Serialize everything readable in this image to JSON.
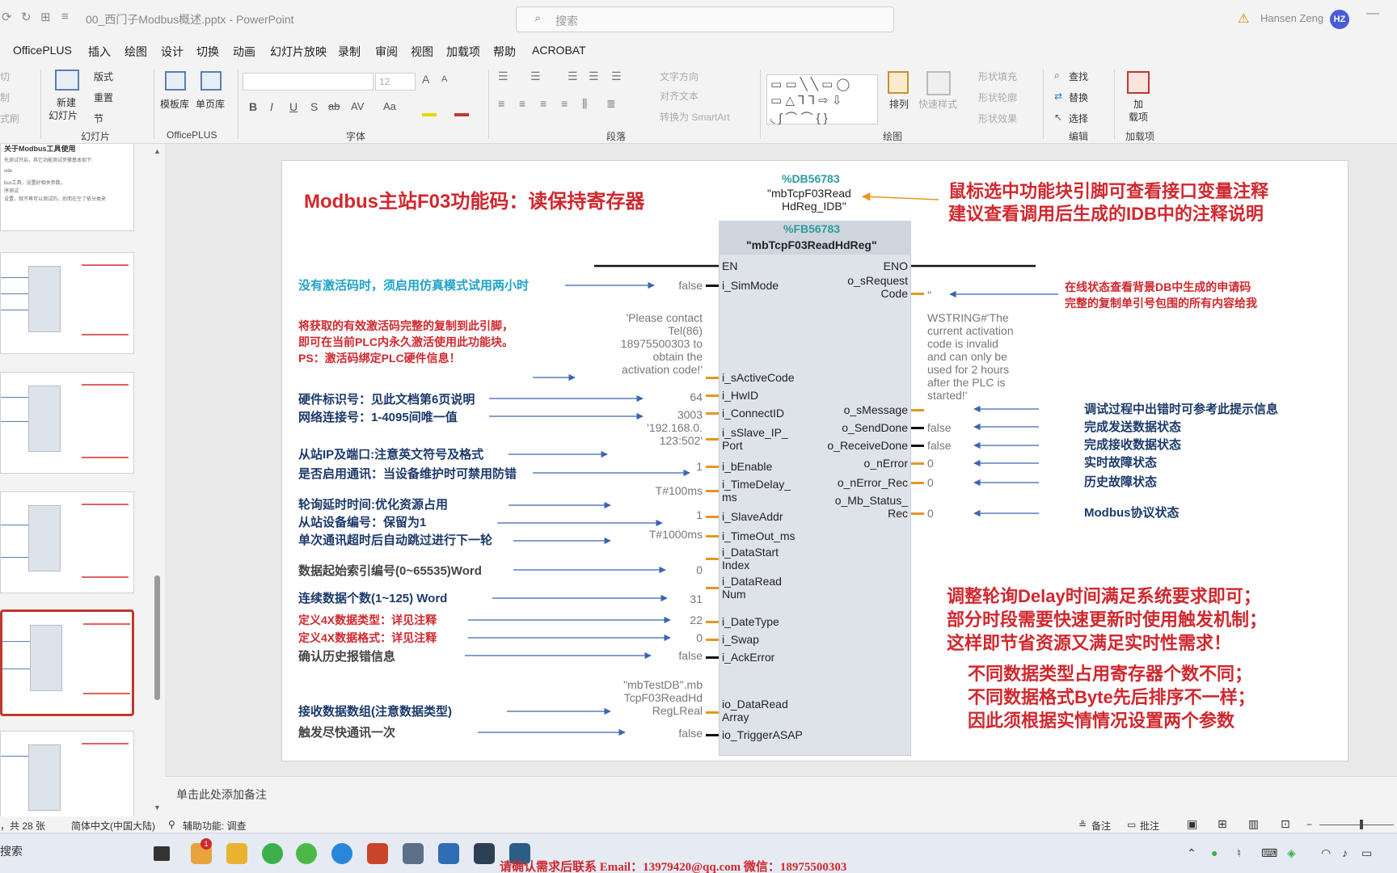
{
  "titlebar": {
    "filename": "00_西门子Modbus概述.pptx - PowerPoint",
    "search_placeholder": "搜索",
    "user_name": "Hansen Zeng",
    "user_initials": "HZ",
    "minimize": "—"
  },
  "menu": [
    "OfficePLUS",
    "插入",
    "绘图",
    "设计",
    "切换",
    "动画",
    "幻灯片放映",
    "录制",
    "审阅",
    "视图",
    "加载项",
    "帮助",
    "ACROBAT"
  ],
  "ribbon": {
    "clip_cut": "切",
    "clip_copy": "制",
    "clip_format": "式刷",
    "slides_group": {
      "new_slide": "新建",
      "new_slide2": "幻灯片",
      "layout": "版式",
      "reset": "重置",
      "section": "节",
      "label": "幻灯片"
    },
    "officeplus_group": {
      "template": "模板库",
      "single_page": "单页库",
      "label": "OfficePLUS"
    },
    "font_group": {
      "font_size": "12",
      "label": "字体",
      "bold": "B",
      "italic": "I",
      "underline": "U",
      "shadow": "S",
      "strike": "ab",
      "spacing": "AV",
      "case": "Aa",
      "grow": "A",
      "shrink": "A"
    },
    "paragraph_group": {
      "text_direction": "文字方向",
      "align_text": "对齐文本",
      "smartart": "转换为 SmartArt",
      "label": "段落"
    },
    "drawing_group": {
      "arrange": "排列",
      "quick_style": "快速样式",
      "fill": "形状填充",
      "outline": "形状轮廓",
      "effect": "形状效果",
      "label": "绘图"
    },
    "editing_group": {
      "find": "查找",
      "replace": "替换",
      "select": "选择",
      "label": "编辑"
    },
    "addins_group": {
      "addin": "加",
      "addin2": "载项",
      "label": "加载项"
    }
  },
  "thumbnail_top_text": {
    "heading": "关于Modbus工具使用",
    "l1": "先测试开启，其它功能测试步骤基本如下:",
    "l2": "ode",
    "l3": "bus工具，设置好相关参数。",
    "l4": "序测试",
    "l5": "设置，就不再可以测试的，后而在空了依分类来"
  },
  "slide": {
    "title": "Modbus主站F03功能码：读保持寄存器",
    "db_number": "%DB56783",
    "db_name_1": "\"mbTcpF03Read",
    "db_name_2": "HdReg_IDB\"",
    "fb_number": "%FB56783",
    "fb_name": "\"mbTcpF03ReadHdReg\"",
    "top_right_note_1": "鼠标选中功能块引脚可查看接口变量注释",
    "top_right_note_2": "建议查看调用后生成的IDB中的注释说明",
    "pins_in": {
      "en": "EN",
      "sim": "i_SimMode",
      "active": "i_sActiveCode",
      "hwid": "i_HwID",
      "connid": "i_ConnectID",
      "slave_ip_1": "i_sSlave_IP_",
      "slave_ip_2": "Port",
      "enable": "i_bEnable",
      "delay_1": "i_TimeDelay_",
      "delay_2": "ms",
      "slaveaddr": "i_SlaveAddr",
      "timeout": "i_TimeOut_ms",
      "start_1": "i_DataStart",
      "start_2": "Index",
      "num_1": "i_DataRead",
      "num_2": "Num",
      "datetype": "i_DateType",
      "swap": "i_Swap",
      "ackerror": "i_AckError",
      "array_1": "io_DataRead",
      "array_2": "Array",
      "trigger": "io_TriggerASAP"
    },
    "pins_out": {
      "eno": "ENO",
      "req_1": "o_sRequest",
      "req_2": "Code",
      "msg": "o_sMessage",
      "senddone": "o_SendDone",
      "recvdone": "o_ReceiveDone",
      "nerror": "o_nError",
      "nerror_rec": "o_nError_Rec",
      "mb_1": "o_Mb_Status_",
      "mb_2": "Rec"
    },
    "values_in": {
      "sim": "false",
      "active_1": "'Please contact",
      "active_2": "Tel(86)",
      "active_3": "18975500303 to",
      "active_4": "obtain the",
      "active_5": "activation code!'",
      "hwid": "64",
      "connid": "3003",
      "ip_1": "'192.168.0.",
      "ip_2": "123:502'",
      "enable": "1",
      "delay": "T#100ms",
      "slaveaddr": "1",
      "timeout": "T#1000ms",
      "start": "0",
      "num": "31",
      "datetype": "22",
      "swap": "0",
      "ackerror": "false",
      "array_1": "\"mbTestDB\".mb",
      "array_2": "TcpF03ReadHd",
      "array_3": "RegLReal",
      "trigger": "false"
    },
    "values_out": {
      "req": "''",
      "msg_1": "WSTRING#'The",
      "msg_2": "current activation",
      "msg_3": "code is invalid",
      "msg_4": "and can only be",
      "msg_5": "used for 2 hours",
      "msg_6": "after the PLC is",
      "msg_7": "started!'",
      "senddone": "false",
      "recvdone": "false",
      "nerror": "0",
      "nerror_rec": "0",
      "mb": "0"
    },
    "notes_left": {
      "sim": "没有激活码时，须启用仿真模式试用两小时",
      "act_1": "将获取的有效激活码完整的复制到此引脚，",
      "act_2": "即可在当前PLC内永久激活使用此功能块。",
      "act_3": "PS：激活码绑定PLC硬件信息！",
      "hwid": "硬件标识号：见此文档第6页说明",
      "connid": "网络连接号：1-4095间唯一值",
      "ip": "从站IP及端口:注意英文符号及格式",
      "enable": "是否启用通讯：当设备维护时可禁用防错",
      "delay": "轮询延时时间:优化资源占用",
      "slave": "从站设备编号：保留为1",
      "timeout": "单次通讯超时后自动跳过进行下一轮",
      "start": "数据起始索引编号(0~65535)Word",
      "num": "连续数据个数(1~125) Word",
      "datetype": "定义4X数据类型：详见注释",
      "swap": "定义4X数据格式：详见注释",
      "ack": "确认历史报错信息",
      "array": "接收数据数组(注意数据类型)",
      "trigger": "触发尽快通讯一次"
    },
    "notes_right": {
      "req_1": "在线状态查看背景DB中生成的申请码",
      "req_2": "完整的复制单引号包围的所有内容给我",
      "msg": "调试过程中出错时可参考此提示信息",
      "send": "完成发送数据状态",
      "recv": "完成接收数据状态",
      "nerror": "实时故障状态",
      "nerror_rec": "历史故障状态",
      "mb": "Modbus协议状态"
    },
    "big_note_1": [
      "调整轮询Delay时间满足系统要求即可；",
      "部分时段需要快速更新时使用触发机制；",
      "这样即节省资源又满足实时性需求！"
    ],
    "big_note_2": [
      "不同数据类型占用寄存器个数不同；",
      "不同数据格式Byte先后排序不一样；",
      "因此须根据实情情况设置两个参数"
    ]
  },
  "notes_placeholder": "单击此处添加备注",
  "statusbar": {
    "slide_count": "，共 28 张",
    "language": "简体中文(中国大陆)",
    "accessibility": "辅助功能: 调查",
    "notes_btn": "备注",
    "comments_btn": "批注"
  },
  "taskbar": {
    "search": "搜索",
    "badge": "1",
    "contact": "请确认需求后联系   Email：13979420@qq.com   微信：18975500303"
  }
}
